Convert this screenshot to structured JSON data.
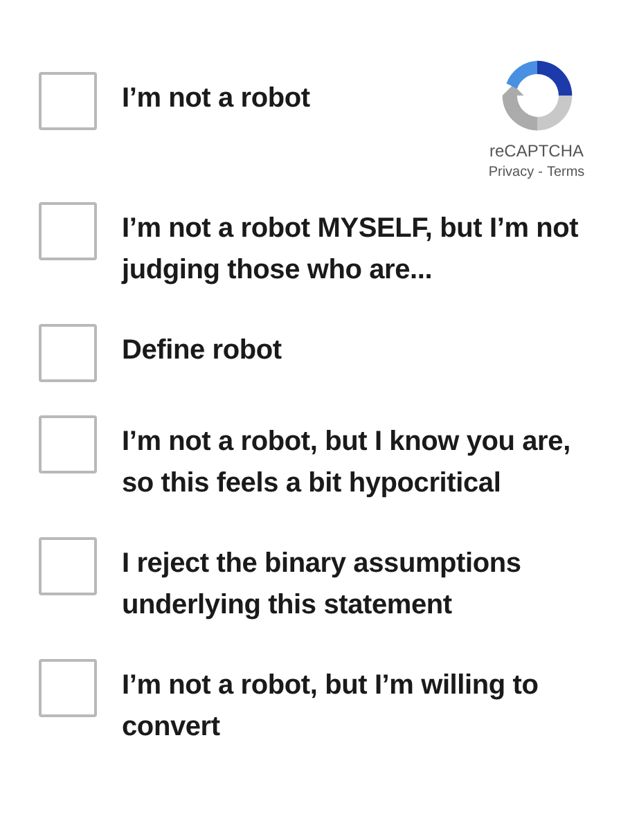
{
  "recaptcha": {
    "name": "reCAPTCHA",
    "links": [
      {
        "label": "Privacy"
      },
      {
        "label": "Terms"
      }
    ],
    "separator": "-"
  },
  "options": [
    {
      "label": "I’m not a robot",
      "checked": false
    },
    {
      "label": "I’m not a robot MYSELF, but I’m not judging those who are...",
      "checked": false
    },
    {
      "label": "Define robot",
      "checked": false
    },
    {
      "label": "I’m not a robot, but I know you are, so this feels a bit hypocritical",
      "checked": false
    },
    {
      "label": "I reject the binary assumptions underlying this statement",
      "checked": false
    },
    {
      "label": "I’m not a robot, but I’m willing to convert",
      "checked": false
    }
  ]
}
